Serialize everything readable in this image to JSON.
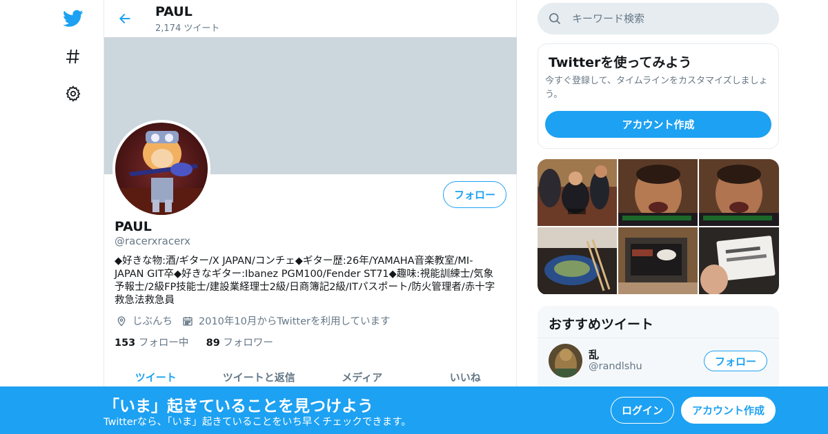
{
  "nav": {
    "logo_icon": "twitter-bird-icon",
    "explore_icon": "hashtag-icon",
    "settings_icon": "gear-icon",
    "accent": "#1da1f2"
  },
  "header": {
    "name": "PAUL",
    "tweet_count": "2,174 ツイート"
  },
  "profile": {
    "follow_label": "フォロー",
    "name": "PAUL",
    "handle": "@racerxracerx",
    "bio_lines": [
      "◆好きな物:酒/ギター/X JAPAN/コンチェ◆ギター歴:26年/YAMAHA音楽教室/MI-",
      "JAPAN GIT卒◆好きなギター:Ibanez PGM100/Fender ST71◆趣味:視能訓練士/気象",
      "予報士/2級FP技能士/建設業経理士2級/日商簿記2級/ITパスポート/防火管理者/赤十字",
      "救急法救急員"
    ],
    "location": "じぶんち",
    "joined": "2010年10月からTwitterを利用しています",
    "following_count": "153",
    "following_label": "フォロー中",
    "followers_count": "89",
    "followers_label": "フォロワー"
  },
  "tabs": [
    {
      "label": "ツイート",
      "active": true
    },
    {
      "label": "ツイートと返信",
      "active": false
    },
    {
      "label": "メディア",
      "active": false
    },
    {
      "label": "いいね",
      "active": false
    }
  ],
  "search": {
    "placeholder": "キーワード検索"
  },
  "signup_card": {
    "title": "Twitterを使ってみよう",
    "text": "今すぐ登録して、タイムラインをカスタマイズしましょう。",
    "button": "アカウント作成"
  },
  "recommend": {
    "title": "おすすめツイート",
    "user": {
      "name": "乱",
      "handle": "@randlshu",
      "follow_label": "フォロー"
    }
  },
  "bottom_bar": {
    "title": "「いま」起きていることを見つけよう",
    "subtitle": "Twitterなら、「いま」起きていることをいち早くチェックできます。",
    "login": "ログイン",
    "signup": "アカウント作成"
  }
}
